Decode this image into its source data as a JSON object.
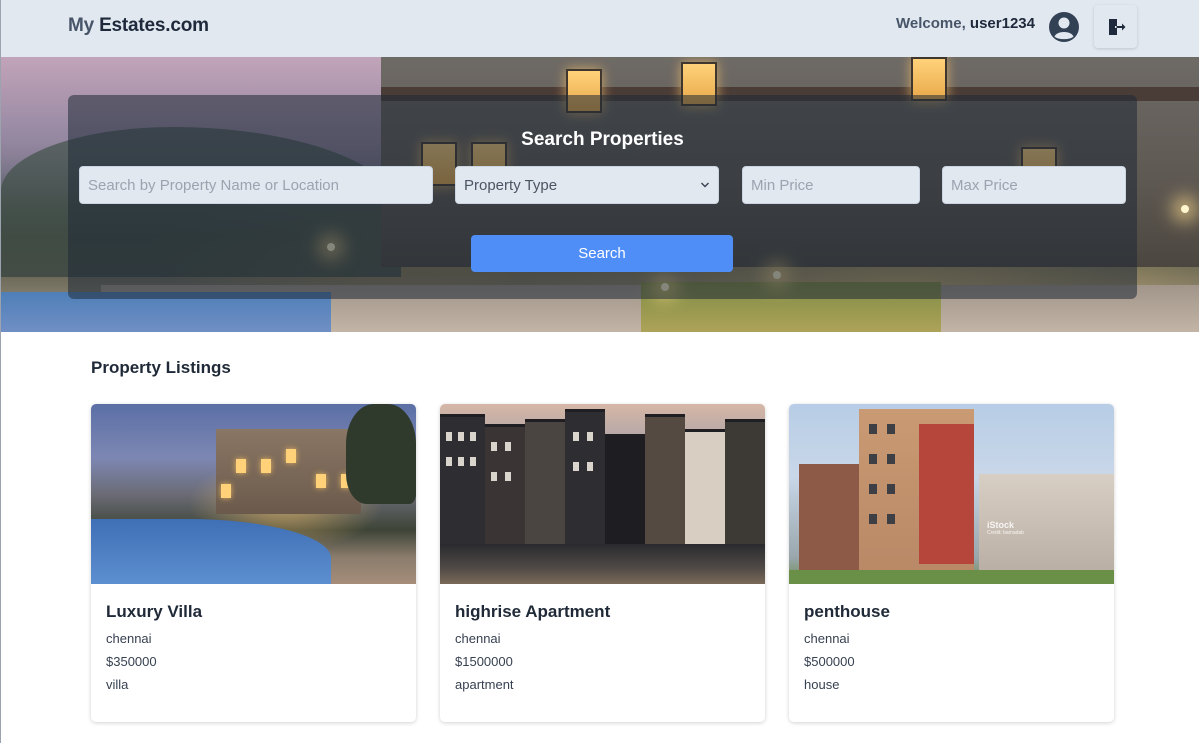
{
  "header": {
    "logo_prefix": "My",
    "logo_main": " Estates.com",
    "welcome_prefix": "Welcome, ",
    "username": "user1234"
  },
  "search": {
    "title": "Search Properties",
    "query_placeholder": "Search by Property Name or Location",
    "property_type_selected": "Property Type",
    "min_price_placeholder": "Min Price",
    "max_price_placeholder": "Max Price",
    "button_label": "Search"
  },
  "listings": {
    "title": "Property Listings",
    "items": [
      {
        "name": "Luxury Villa",
        "location": "chennai",
        "price": "$350000",
        "type": "villa"
      },
      {
        "name": "highrise Apartment",
        "location": "chennai",
        "price": "$1500000",
        "type": "apartment"
      },
      {
        "name": "penthouse",
        "location": "chennai",
        "price": "$500000",
        "type": "house"
      }
    ],
    "watermark": "iStock",
    "watermark_credit": "Credit: bamadab"
  },
  "colors": {
    "header_bg": "#e2e8f0",
    "primary_button": "#4f8ef7",
    "panel_overlay": "rgba(31,41,55,0.55)"
  },
  "icons": {
    "avatar": "user-circle-icon",
    "logout": "logout-icon",
    "select_arrow": "chevron-down-icon"
  }
}
